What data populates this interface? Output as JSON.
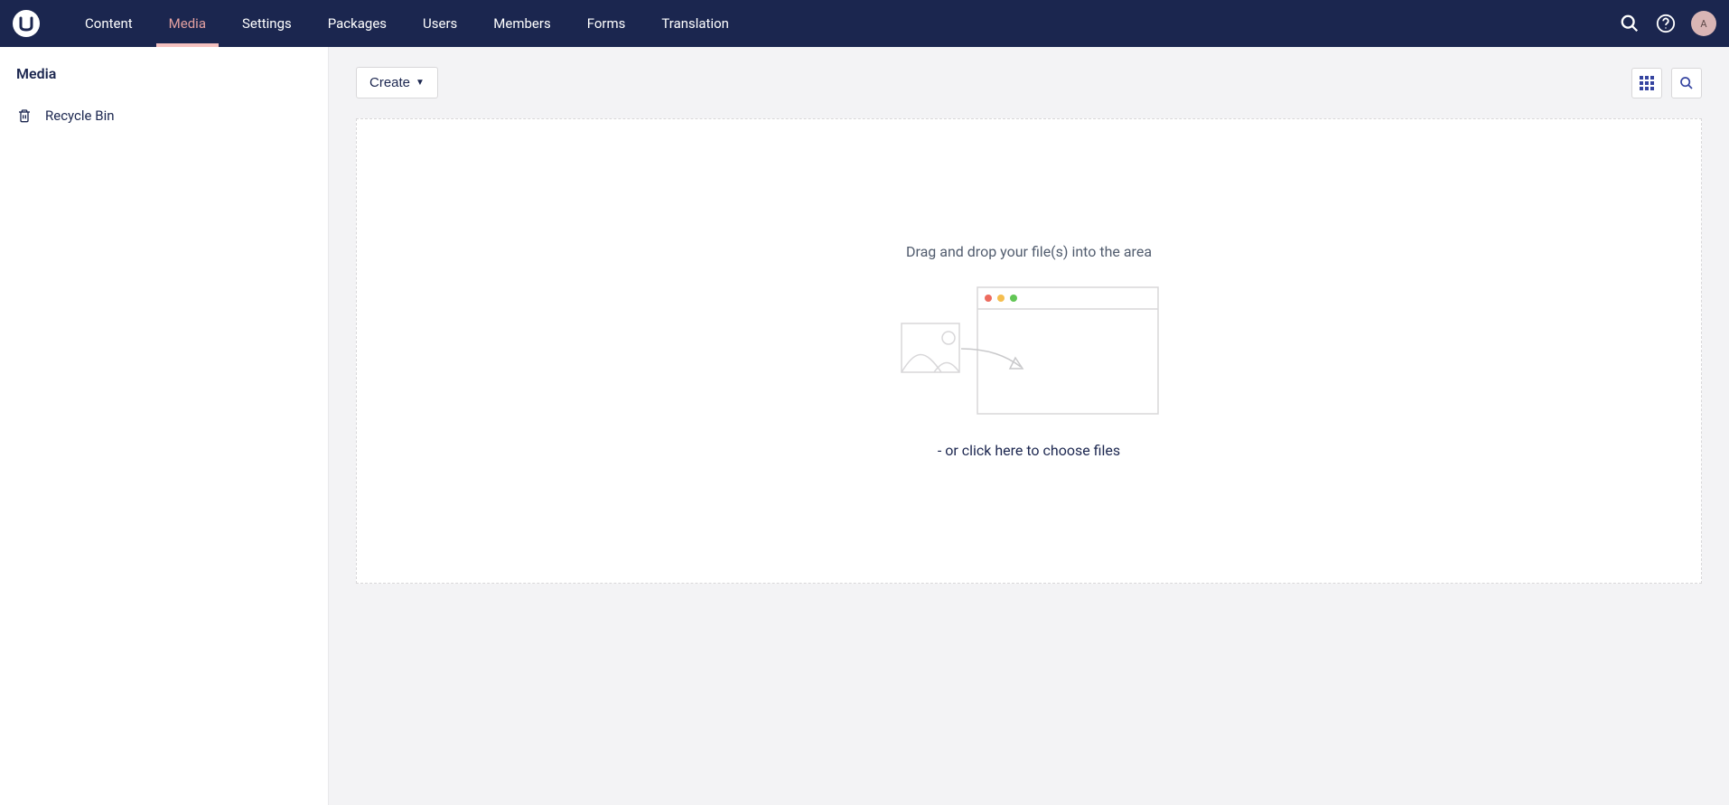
{
  "nav": {
    "tabs": [
      {
        "label": "Content",
        "active": false
      },
      {
        "label": "Media",
        "active": true
      },
      {
        "label": "Settings",
        "active": false
      },
      {
        "label": "Packages",
        "active": false
      },
      {
        "label": "Users",
        "active": false
      },
      {
        "label": "Members",
        "active": false
      },
      {
        "label": "Forms",
        "active": false
      },
      {
        "label": "Translation",
        "active": false
      }
    ],
    "avatar_initial": "A"
  },
  "sidebar": {
    "title": "Media",
    "items": [
      {
        "icon": "trash",
        "label": "Recycle Bin"
      }
    ]
  },
  "toolbar": {
    "create_label": "Create"
  },
  "dropzone": {
    "instruction": "Drag and drop your file(s) into the area",
    "link_text": "- or click here to choose files"
  }
}
